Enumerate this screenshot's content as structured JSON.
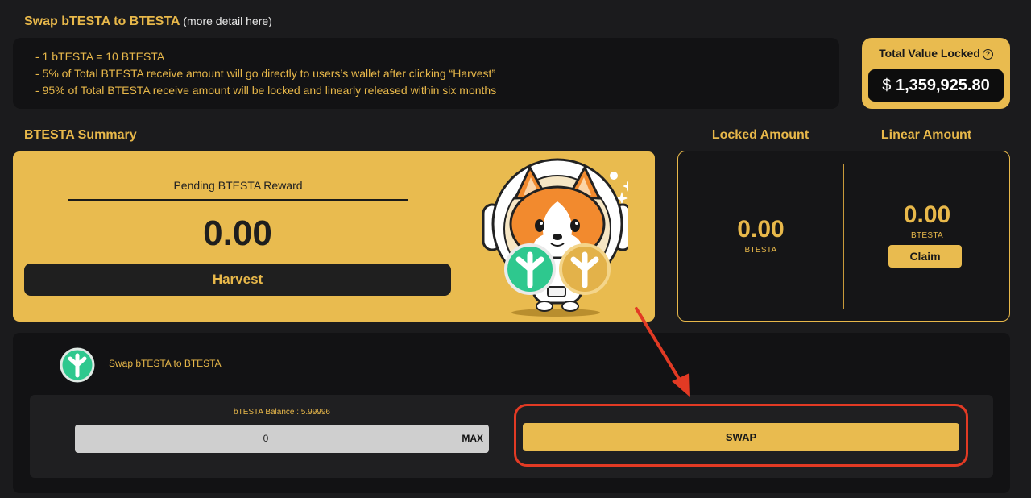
{
  "header": {
    "title": "Swap bTESTA to BTESTA",
    "detail_link": "(more detail here)"
  },
  "info": {
    "lines": [
      "- 1 bTESTA = 10 BTESTA",
      "- 5% of Total BTESTA receive amount will go directly to users’s wallet after clicking “Harvest”",
      "- 95% of Total BTESTA receive amount will be locked and linearly released within six months"
    ]
  },
  "tvl": {
    "title": "Total Value Locked",
    "help_glyph": "?",
    "currency": "$",
    "value": "1,359,925.80"
  },
  "summary": {
    "title": "BTESTA Summary",
    "pending_label": "Pending BTESTA Reward",
    "pending_value": "0.00",
    "harvest_label": "Harvest"
  },
  "locked": {
    "locked_title": "Locked Amount",
    "linear_title": "Linear Amount",
    "locked_value": "0.00",
    "locked_unit": "BTESTA",
    "linear_value": "0.00",
    "linear_unit": "BTESTA",
    "claim_label": "Claim"
  },
  "swap": {
    "label": "Swap bTESTA to BTESTA",
    "balance_label": "bTESTA Balance : 5.99996",
    "amount_value": "0",
    "max_label": "MAX",
    "swap_label": "SWAP"
  },
  "colors": {
    "background": "#1b1b1d",
    "accent": "#e9bb4f",
    "panel": "#121214",
    "highlight": "#e23a24",
    "token_green": "#2ec88e"
  },
  "icons": {
    "help": "question-circle-icon",
    "token": "btesta-token-icon",
    "mascot": "corgi-astronaut-mascot",
    "arrow": "red-arrow-annotation"
  }
}
